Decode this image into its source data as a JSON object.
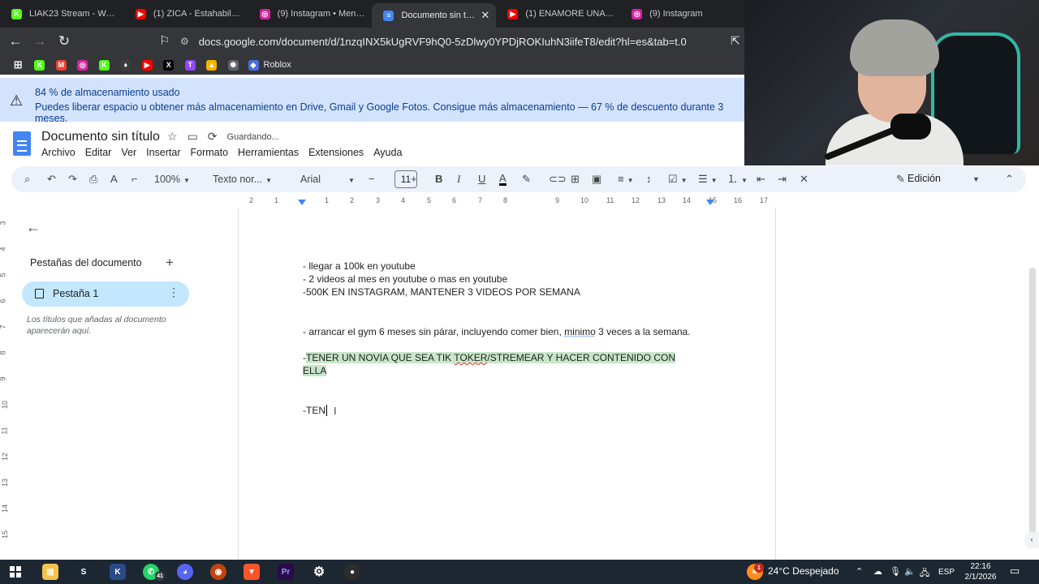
{
  "browser": {
    "tabs": [
      {
        "title": "LIAK23 Stream - Watc",
        "favicon": "kick-icon",
        "color": "#53fc18",
        "glyph": "K",
        "active": false
      },
      {
        "title": "(1) ZICA - Estahabilidad [R",
        "favicon": "youtube-icon",
        "color": "#ff0000",
        "glyph": "▶",
        "active": false
      },
      {
        "title": "(9) Instagram • Mensajes",
        "favicon": "instagram-icon",
        "color": "#d6249f",
        "glyph": "◎",
        "active": false
      },
      {
        "title": "Documento sin título",
        "favicon": "google-docs-icon",
        "color": "#4285f4",
        "glyph": "≡",
        "active": true
      },
      {
        "title": "(1) ENAMORE UNA TIK TO",
        "favicon": "youtube-icon",
        "color": "#ff0000",
        "glyph": "▶",
        "active": false
      },
      {
        "title": "(9) Instagram",
        "favicon": "instagram-icon",
        "color": "#d6249f",
        "glyph": "◎",
        "active": false
      }
    ],
    "url": "docs.google.com/document/d/1nzqINX5kUgRVF9hQ0-5zDlwy0YPDjROKIuhN3iifeT8/edit?hl=es&tab=t.0",
    "bookmarks": [
      {
        "name": "apps-grid-icon",
        "color": "transparent",
        "glyph": "⊞"
      },
      {
        "name": "kick-icon",
        "color": "#53fc18",
        "glyph": "K"
      },
      {
        "name": "gmail-icon",
        "color": "#ea4335",
        "glyph": "M"
      },
      {
        "name": "instagram-icon",
        "color": "#d6249f",
        "glyph": "◎"
      },
      {
        "name": "kick-icon",
        "color": "#53fc18",
        "glyph": "K"
      },
      {
        "name": "ethereum-icon",
        "color": "#3c3c3d",
        "glyph": "♦"
      },
      {
        "name": "youtube-icon",
        "color": "#ff0000",
        "glyph": "▶"
      },
      {
        "name": "x-icon",
        "color": "#000000",
        "glyph": "X"
      },
      {
        "name": "twitch-icon",
        "color": "#9146ff",
        "glyph": "T"
      },
      {
        "name": "drive-icon",
        "color": "#f4b400",
        "glyph": "▲"
      },
      {
        "name": "chatgpt-icon",
        "color": "#5f6368",
        "glyph": "✺"
      }
    ],
    "bookmark_roblox": "Roblox"
  },
  "banner": {
    "title": "84 % de almacenamiento usado",
    "message": "Puedes liberar espacio u obtener más almacenamiento en Drive, Gmail y Google Fotos. Consigue más almacenamiento — 67 % de descuento durante 3 meses."
  },
  "docs": {
    "title": "Documento sin título",
    "status": "Guardando...",
    "menu": [
      "Archivo",
      "Editar",
      "Ver",
      "Insertar",
      "Formato",
      "Herramientas",
      "Extensiones",
      "Ayuda"
    ],
    "toolbar": {
      "zoom": "100%",
      "style": "Texto nor...",
      "font": "Arial",
      "font_size": "11",
      "mode": "Edición"
    },
    "ruler_ticks": [
      "2",
      "1",
      "1",
      "2",
      "3",
      "4",
      "5",
      "6",
      "7",
      "8",
      "9",
      "10",
      "11",
      "12",
      "13",
      "14",
      "15",
      "16",
      "17",
      "18"
    ],
    "vruler_ticks": [
      "3",
      "4",
      "5",
      "6",
      "7",
      "8",
      "9",
      "10",
      "11",
      "12",
      "13",
      "14",
      "15"
    ],
    "sidebar": {
      "title": "Pestañas del documento",
      "tab_label": "Pestaña 1",
      "hint": "Los títulos que añadas al documento aparecerán aquí."
    },
    "content": {
      "l1": "- llegar a 100k en youtube",
      "l2": "- 2 videos al mes en youtube o mas en youtube",
      "l3": "-500K EN INSTAGRAM, MANTENER 3 VIDEOS POR SEMANA",
      "l4_a": "- arrancar el gym 6 meses sin párar, incluyendo comer bien, ",
      "l4_b": "minimo",
      "l4_c": " 3 veces a la semana.",
      "l5_dash": "-",
      "l5_a": "TENER UN NOVIA QUE SEA TIK ",
      "l5_b": "TOKER",
      "l5_c": "/STREMEAR Y HACER CONTENIDO CON",
      "l6": "ELLA",
      "l7": "-TEN"
    }
  },
  "taskbar": {
    "weather": "24°C  Despejado",
    "lang": "ESP",
    "time": "22:16",
    "date": "2/1/2026",
    "whatsapp_badge": "41",
    "weather_badge": "1"
  }
}
